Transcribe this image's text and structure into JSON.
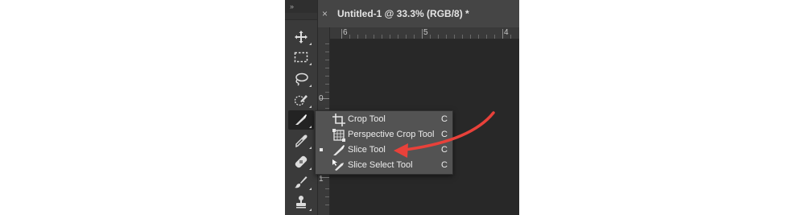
{
  "toolbar": {
    "grip": "››",
    "tools": [
      {
        "name": "move-tool"
      },
      {
        "name": "rectangular-marquee-tool"
      },
      {
        "name": "lasso-tool"
      },
      {
        "name": "quick-selection-tool"
      },
      {
        "name": "slice-tool",
        "active": true
      },
      {
        "name": "eyedropper-tool"
      },
      {
        "name": "healing-brush-tool"
      },
      {
        "name": "brush-tool"
      },
      {
        "name": "clone-stamp-tool"
      }
    ]
  },
  "document_tab": {
    "close": "×",
    "title": "Untitled-1 @ 33.3% (RGB/8) *"
  },
  "rulers": {
    "horizontal_labels": [
      "6",
      "5",
      "4"
    ],
    "vertical_labels": [
      "0",
      "1"
    ]
  },
  "flyout_menu": {
    "items": [
      {
        "label": "Crop Tool",
        "shortcut": "C",
        "icon": "crop-icon",
        "selected": false
      },
      {
        "label": "Perspective Crop Tool",
        "shortcut": "C",
        "icon": "perspective-crop-icon",
        "selected": false
      },
      {
        "label": "Slice Tool",
        "shortcut": "C",
        "icon": "slice-icon",
        "selected": true
      },
      {
        "label": "Slice Select Tool",
        "shortcut": "C",
        "icon": "slice-select-icon",
        "selected": false
      }
    ]
  },
  "annotation": {
    "color": "#e8413a",
    "icon": "red-arrow-icon"
  }
}
